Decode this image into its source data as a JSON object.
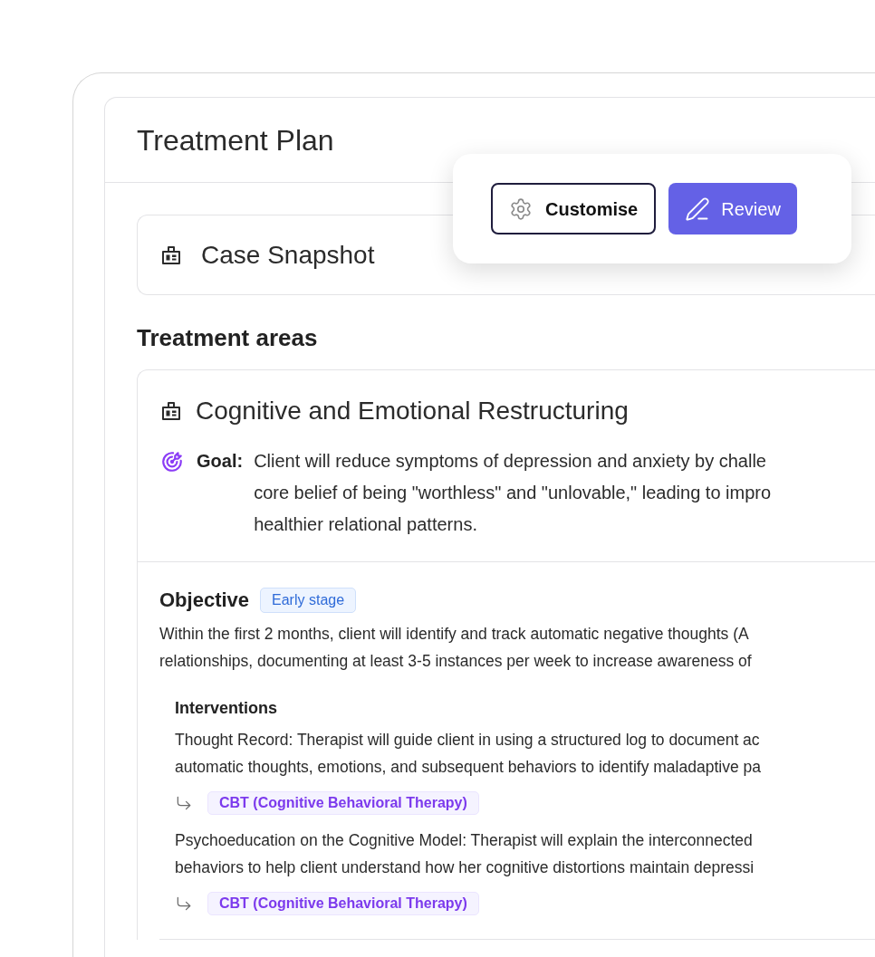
{
  "header": {
    "title": "Treatment Plan"
  },
  "toolbar": {
    "buttons": [
      {
        "kind": "secondary",
        "label": "Customise"
      },
      {
        "kind": "primary",
        "label": "Review"
      }
    ]
  },
  "case_snapshot": {
    "title": "Case Snapshot"
  },
  "treatment_areas": {
    "heading": "Treatment areas",
    "areas": [
      {
        "title": "Cognitive and Emotional Restructuring",
        "goal": {
          "label": "Goal:",
          "lines": [
            "Client will reduce symptoms of depression and anxiety by challe",
            "core belief of being \"worthless\" and \"unlovable,\" leading to impro",
            "healthier relational patterns."
          ]
        },
        "objectives": [
          {
            "label": "Objective",
            "stage": "Early stage",
            "lines": [
              "Within the first 2 months, client will identify and track automatic negative thoughts (A",
              "relationships, documenting at least 3-5 instances per week to increase awareness of"
            ],
            "interventions_heading": "Interventions",
            "interventions": [
              {
                "lines": [
                  "Thought Record: Therapist will guide client in using a structured log to document ac",
                  "automatic thoughts, emotions, and subsequent behaviors to identify maladaptive pa"
                ],
                "modality": "CBT (Cognitive Behavioral Therapy)"
              },
              {
                "lines": [
                  "Psychoeducation on the Cognitive Model: Therapist will explain the interconnected",
                  "behaviors to help client understand how her cognitive distortions maintain depressi"
                ],
                "modality": "CBT (Cognitive Behavioral Therapy)"
              }
            ]
          }
        ]
      }
    ]
  }
}
